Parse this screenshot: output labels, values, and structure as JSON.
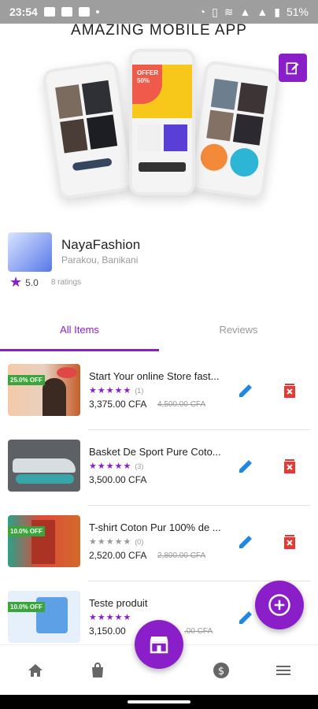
{
  "status_bar": {
    "time": "23:54",
    "battery": "51%"
  },
  "banner": {
    "title": "AMAZING MOBILE APP",
    "phone_promo": "OFFER 50%"
  },
  "store": {
    "name": "NayaFashion",
    "location": "Parakou, Banikani",
    "rating": "5.0",
    "ratings_count": "8 ratings"
  },
  "tabs": [
    {
      "label": "All Items"
    },
    {
      "label": "Reviews"
    }
  ],
  "products": [
    {
      "title": "Start Your online Store fast...",
      "badge": "25.0% OFF",
      "stars": "★★★★★",
      "reviews": "(1)",
      "price": "3,375.00 CFA",
      "old_price": "4,500.00 CFA"
    },
    {
      "title": "Basket De Sport Pure Coto...",
      "badge": "",
      "stars": "★★★★★",
      "reviews": "(3)",
      "price": "3,500.00 CFA",
      "old_price": ""
    },
    {
      "title": "T-shirt Coton Pur 100% de ...",
      "badge": "10.0% OFF",
      "stars": "★★★★★",
      "reviews": "(0)",
      "price": "2,520.00 CFA",
      "old_price": "2,800.00 CFA"
    },
    {
      "title": "Teste produit",
      "badge": "10.0% OFF",
      "stars": "★★★★★",
      "reviews": "",
      "price": "3,150.00",
      "old_price": ".00 CFA"
    }
  ],
  "colors": {
    "accent": "#8a1fc9",
    "edit": "#1e88e5",
    "delete": "#e53935"
  },
  "icons": {
    "edit": "edit-icon",
    "delete": "delete-icon",
    "add": "plus-icon",
    "store": "store-icon",
    "home": "home-icon",
    "bag": "bag-icon",
    "money": "dollar-icon",
    "menu": "menu-icon"
  }
}
